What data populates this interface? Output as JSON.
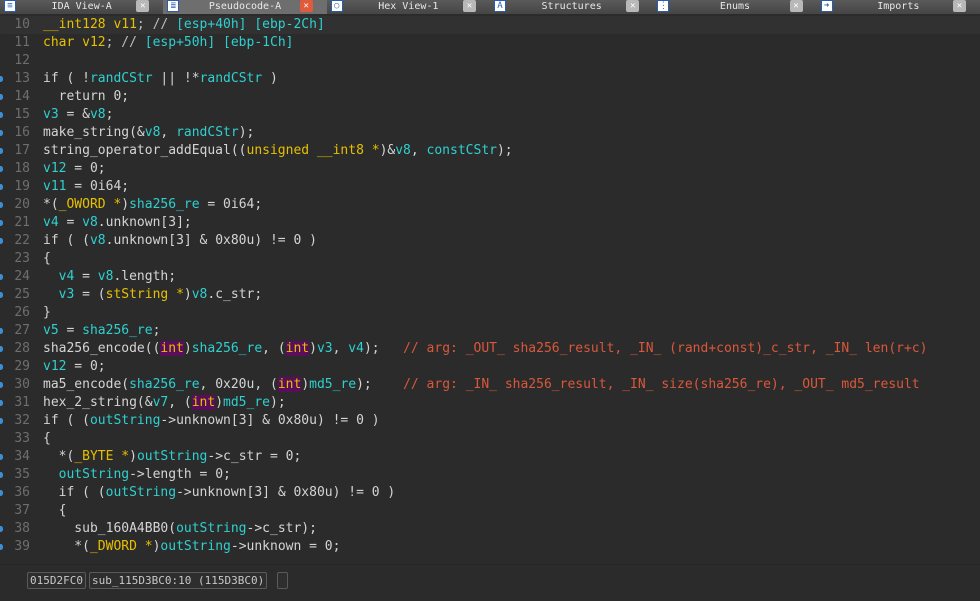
{
  "tabs": [
    {
      "label": "IDA View-A",
      "icon": "disassembly-icon",
      "active": false
    },
    {
      "label": "Pseudocode-A",
      "icon": "pseudocode-icon",
      "active": true
    },
    {
      "label": "Hex View-1",
      "icon": "hex-icon",
      "active": false
    },
    {
      "label": "Structures",
      "icon": "structures-icon",
      "active": false
    },
    {
      "label": "Enums",
      "icon": "enums-icon",
      "active": false
    },
    {
      "label": "Imports",
      "icon": "imports-icon",
      "active": false
    }
  ],
  "colors": {
    "keyword": "#e6c000",
    "identifier": "#2fd0d0",
    "comment": "#d9583b",
    "text": "#d4d4d4",
    "cast_highlight": "#5a0d5a",
    "background": "#2b2b2b"
  },
  "lines": [
    {
      "n": "10",
      "dot": false,
      "tokens": [
        [
          "k",
          "__int128 v11"
        ],
        [
          "p",
          "; // "
        ],
        [
          "v",
          "[esp+40h] [ebp-2Ch]"
        ]
      ]
    },
    {
      "n": "11",
      "dot": false,
      "tokens": [
        [
          "k",
          "char v12"
        ],
        [
          "p",
          "; // "
        ],
        [
          "v",
          "[esp+50h] [ebp-1Ch]"
        ]
      ]
    },
    {
      "n": "12",
      "dot": false,
      "tokens": []
    },
    {
      "n": "13",
      "dot": true,
      "tokens": [
        [
          "t",
          "if ( !"
        ],
        [
          "v",
          "randCStr"
        ],
        [
          "t",
          " || !*"
        ],
        [
          "v",
          "randCStr"
        ],
        [
          "t",
          " )"
        ]
      ]
    },
    {
      "n": "14",
      "dot": true,
      "tokens": [
        [
          "t",
          "  return 0;"
        ]
      ]
    },
    {
      "n": "15",
      "dot": true,
      "tokens": [
        [
          "v",
          "v3"
        ],
        [
          "t",
          " = &"
        ],
        [
          "v",
          "v8"
        ],
        [
          "t",
          ";"
        ]
      ]
    },
    {
      "n": "16",
      "dot": true,
      "tokens": [
        [
          "t",
          "make_string(&"
        ],
        [
          "v",
          "v8"
        ],
        [
          "t",
          ", "
        ],
        [
          "v",
          "randCStr"
        ],
        [
          "t",
          ");"
        ]
      ]
    },
    {
      "n": "17",
      "dot": true,
      "tokens": [
        [
          "t",
          "string_operator_addEqual(("
        ],
        [
          "k",
          "unsigned __int8 *"
        ],
        [
          "t",
          ")&"
        ],
        [
          "v",
          "v8"
        ],
        [
          "t",
          ", "
        ],
        [
          "v",
          "constCStr"
        ],
        [
          "t",
          ");"
        ]
      ]
    },
    {
      "n": "18",
      "dot": true,
      "tokens": [
        [
          "v",
          "v12"
        ],
        [
          "t",
          " = 0;"
        ]
      ]
    },
    {
      "n": "19",
      "dot": true,
      "tokens": [
        [
          "v",
          "v11"
        ],
        [
          "t",
          " = 0i64;"
        ]
      ]
    },
    {
      "n": "20",
      "dot": true,
      "tokens": [
        [
          "t",
          "*("
        ],
        [
          "k",
          "_OWORD *"
        ],
        [
          "t",
          ")"
        ],
        [
          "v",
          "sha256_re"
        ],
        [
          "t",
          " = 0i64;"
        ]
      ]
    },
    {
      "n": "21",
      "dot": true,
      "tokens": [
        [
          "v",
          "v4"
        ],
        [
          "t",
          " = "
        ],
        [
          "v",
          "v8"
        ],
        [
          "t",
          ".unknown[3];"
        ]
      ]
    },
    {
      "n": "22",
      "dot": true,
      "tokens": [
        [
          "t",
          "if ( ("
        ],
        [
          "v",
          "v8"
        ],
        [
          "t",
          ".unknown[3] & 0x80u) != 0 )"
        ]
      ]
    },
    {
      "n": "23",
      "dot": false,
      "tokens": [
        [
          "t",
          "{"
        ]
      ]
    },
    {
      "n": "24",
      "dot": true,
      "tokens": [
        [
          "t",
          "  "
        ],
        [
          "v",
          "v4"
        ],
        [
          "t",
          " = "
        ],
        [
          "v",
          "v8"
        ],
        [
          "t",
          ".length;"
        ]
      ]
    },
    {
      "n": "25",
      "dot": true,
      "tokens": [
        [
          "t",
          "  "
        ],
        [
          "v",
          "v3"
        ],
        [
          "t",
          " = ("
        ],
        [
          "k",
          "stString *"
        ],
        [
          "t",
          ")"
        ],
        [
          "v",
          "v8"
        ],
        [
          "t",
          ".c_str;"
        ]
      ]
    },
    {
      "n": "26",
      "dot": false,
      "tokens": [
        [
          "t",
          "}"
        ]
      ]
    },
    {
      "n": "27",
      "dot": true,
      "tokens": [
        [
          "v",
          "v5"
        ],
        [
          "t",
          " = "
        ],
        [
          "v",
          "sha256_re"
        ],
        [
          "t",
          ";"
        ]
      ]
    },
    {
      "n": "28",
      "dot": true,
      "tokens": [
        [
          "t",
          "sha256_encode(("
        ],
        [
          "h",
          "int"
        ],
        [
          "t",
          ")"
        ],
        [
          "v",
          "sha256_re"
        ],
        [
          "t",
          ", ("
        ],
        [
          "h",
          "int"
        ],
        [
          "t",
          ")"
        ],
        [
          "v",
          "v3"
        ],
        [
          "t",
          ", "
        ],
        [
          "v",
          "v4"
        ],
        [
          "t",
          ");   "
        ],
        [
          "c",
          "// arg: _OUT_ sha256_result, _IN_ (rand+const)_c_str, _IN_ len(r+c)"
        ]
      ]
    },
    {
      "n": "29",
      "dot": true,
      "tokens": [
        [
          "v",
          "v12"
        ],
        [
          "t",
          " = 0;"
        ]
      ]
    },
    {
      "n": "30",
      "dot": true,
      "tokens": [
        [
          "t",
          "ma5_encode("
        ],
        [
          "v",
          "sha256_re"
        ],
        [
          "t",
          ", 0x20u, ("
        ],
        [
          "h",
          "int"
        ],
        [
          "t",
          ")"
        ],
        [
          "v",
          "md5_re"
        ],
        [
          "t",
          ");    "
        ],
        [
          "c",
          "// arg: _IN_ sha256_result, _IN_ size(sha256_re), _OUT_ md5_result"
        ]
      ]
    },
    {
      "n": "31",
      "dot": true,
      "tokens": [
        [
          "t",
          "hex_2_string(&"
        ],
        [
          "v",
          "v7"
        ],
        [
          "t",
          ", ("
        ],
        [
          "h",
          "int"
        ],
        [
          "t",
          ")"
        ],
        [
          "v",
          "md5_re"
        ],
        [
          "t",
          ");"
        ]
      ]
    },
    {
      "n": "32",
      "dot": true,
      "tokens": [
        [
          "t",
          "if ( ("
        ],
        [
          "v",
          "outString"
        ],
        [
          "t",
          "->unknown[3] & 0x80u) != 0 )"
        ]
      ]
    },
    {
      "n": "33",
      "dot": false,
      "tokens": [
        [
          "t",
          "{"
        ]
      ]
    },
    {
      "n": "34",
      "dot": true,
      "tokens": [
        [
          "t",
          "  *("
        ],
        [
          "k",
          "_BYTE *"
        ],
        [
          "t",
          ")"
        ],
        [
          "v",
          "outString"
        ],
        [
          "t",
          "->c_str = 0;"
        ]
      ]
    },
    {
      "n": "35",
      "dot": true,
      "tokens": [
        [
          "t",
          "  "
        ],
        [
          "v",
          "outString"
        ],
        [
          "t",
          "->length = 0;"
        ]
      ]
    },
    {
      "n": "36",
      "dot": true,
      "tokens": [
        [
          "t",
          "  if ( ("
        ],
        [
          "v",
          "outString"
        ],
        [
          "t",
          "->unknown[3] & 0x80u) != 0 )"
        ]
      ]
    },
    {
      "n": "37",
      "dot": false,
      "tokens": [
        [
          "t",
          "  {"
        ]
      ]
    },
    {
      "n": "38",
      "dot": true,
      "tokens": [
        [
          "t",
          "    sub_160A4BB0("
        ],
        [
          "v",
          "outString"
        ],
        [
          "t",
          "->c_str);"
        ]
      ]
    },
    {
      "n": "39",
      "dot": true,
      "tokens": [
        [
          "t",
          "    *("
        ],
        [
          "k",
          "_DWORD *"
        ],
        [
          "t",
          ")"
        ],
        [
          "v",
          "outString"
        ],
        [
          "t",
          "->unknown = 0;"
        ]
      ]
    }
  ],
  "status": {
    "address": "015D2FC0",
    "location": "sub_115D3BC0:10 (115D3BC0)",
    "extra": ""
  }
}
